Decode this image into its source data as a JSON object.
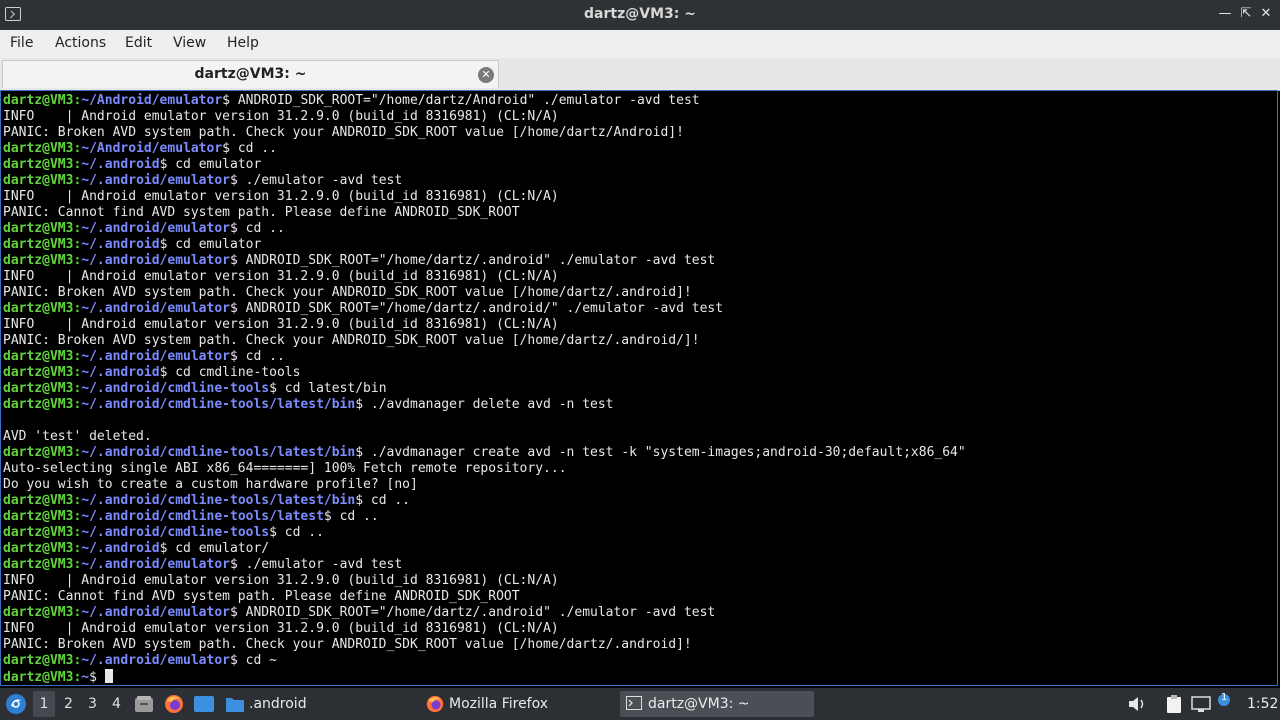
{
  "window": {
    "title": "dartz@VM3: ~"
  },
  "menu": [
    "File",
    "Actions",
    "Edit",
    "View",
    "Help"
  ],
  "tab": {
    "label": "dartz@VM3: ~"
  },
  "terminal": {
    "lines": [
      {
        "u": "dartz@VM3",
        "p": "~/Android/emulator",
        "c": "ANDROID_SDK_ROOT=\"/home/dartz/Android\" ./emulator -avd test"
      },
      {
        "t": "INFO    | Android emulator version 31.2.9.0 (build_id 8316981) (CL:N/A)"
      },
      {
        "t": "PANIC: Broken AVD system path. Check your ANDROID_SDK_ROOT value [/home/dartz/Android]!"
      },
      {
        "u": "dartz@VM3",
        "p": "~/Android/emulator",
        "c": "cd .."
      },
      {
        "u": "dartz@VM3",
        "p": "~/.android",
        "c": "cd emulator"
      },
      {
        "u": "dartz@VM3",
        "p": "~/.android/emulator",
        "c": "./emulator -avd test"
      },
      {
        "t": "INFO    | Android emulator version 31.2.9.0 (build_id 8316981) (CL:N/A)"
      },
      {
        "t": "PANIC: Cannot find AVD system path. Please define ANDROID_SDK_ROOT"
      },
      {
        "u": "dartz@VM3",
        "p": "~/.android/emulator",
        "c": "cd .."
      },
      {
        "u": "dartz@VM3",
        "p": "~/.android",
        "c": "cd emulator"
      },
      {
        "u": "dartz@VM3",
        "p": "~/.android/emulator",
        "c": "ANDROID_SDK_ROOT=\"/home/dartz/.android\" ./emulator -avd test"
      },
      {
        "t": "INFO    | Android emulator version 31.2.9.0 (build_id 8316981) (CL:N/A)"
      },
      {
        "t": "PANIC: Broken AVD system path. Check your ANDROID_SDK_ROOT value [/home/dartz/.android]!"
      },
      {
        "u": "dartz@VM3",
        "p": "~/.android/emulator",
        "c": "ANDROID_SDK_ROOT=\"/home/dartz/.android/\" ./emulator -avd test"
      },
      {
        "t": "INFO    | Android emulator version 31.2.9.0 (build_id 8316981) (CL:N/A)"
      },
      {
        "t": "PANIC: Broken AVD system path. Check your ANDROID_SDK_ROOT value [/home/dartz/.android/]!"
      },
      {
        "u": "dartz@VM3",
        "p": "~/.android/emulator",
        "c": "cd .."
      },
      {
        "u": "dartz@VM3",
        "p": "~/.android",
        "c": "cd cmdline-tools"
      },
      {
        "u": "dartz@VM3",
        "p": "~/.android/cmdline-tools",
        "c": "cd latest/bin"
      },
      {
        "u": "dartz@VM3",
        "p": "~/.android/cmdline-tools/latest/bin",
        "c": "./avdmanager delete avd -n test"
      },
      {
        "t": ""
      },
      {
        "t": "AVD 'test' deleted."
      },
      {
        "u": "dartz@VM3",
        "p": "~/.android/cmdline-tools/latest/bin",
        "c": "./avdmanager create avd -n test -k \"system-images;android-30;default;x86_64\""
      },
      {
        "t": "Auto-selecting single ABI x86_64=======] 100% Fetch remote repository..."
      },
      {
        "t": "Do you wish to create a custom hardware profile? [no]"
      },
      {
        "u": "dartz@VM3",
        "p": "~/.android/cmdline-tools/latest/bin",
        "c": "cd .."
      },
      {
        "u": "dartz@VM3",
        "p": "~/.android/cmdline-tools/latest",
        "c": "cd .."
      },
      {
        "u": "dartz@VM3",
        "p": "~/.android/cmdline-tools",
        "c": "cd .."
      },
      {
        "u": "dartz@VM3",
        "p": "~/.android",
        "c": "cd emulator/"
      },
      {
        "u": "dartz@VM3",
        "p": "~/.android/emulator",
        "c": "./emulator -avd test"
      },
      {
        "t": "INFO    | Android emulator version 31.2.9.0 (build_id 8316981) (CL:N/A)"
      },
      {
        "t": "PANIC: Cannot find AVD system path. Please define ANDROID_SDK_ROOT"
      },
      {
        "u": "dartz@VM3",
        "p": "~/.android/emulator",
        "c": "ANDROID_SDK_ROOT=\"/home/dartz/.android\" ./emulator -avd test"
      },
      {
        "t": "INFO    | Android emulator version 31.2.9.0 (build_id 8316981) (CL:N/A)"
      },
      {
        "t": "PANIC: Broken AVD system path. Check your ANDROID_SDK_ROOT value [/home/dartz/.android]!"
      },
      {
        "u": "dartz@VM3",
        "p": "~/.android/emulator",
        "c": "cd ~"
      },
      {
        "u": "dartz@VM3",
        "p": "~",
        "c": "",
        "cursor": true
      }
    ]
  },
  "taskbar": {
    "workspaces": [
      "1",
      "2",
      "3",
      "4"
    ],
    "folder_label": ".android",
    "firefox_label": "Mozilla Firefox",
    "terminal_label": "dartz@VM3: ~",
    "clock": "1:52",
    "notify_count": "1"
  },
  "colors": {
    "user": "#62d53d",
    "path": "#7c8cff",
    "taskbar": "#2c2f33",
    "titlebar": "#2e3235"
  }
}
